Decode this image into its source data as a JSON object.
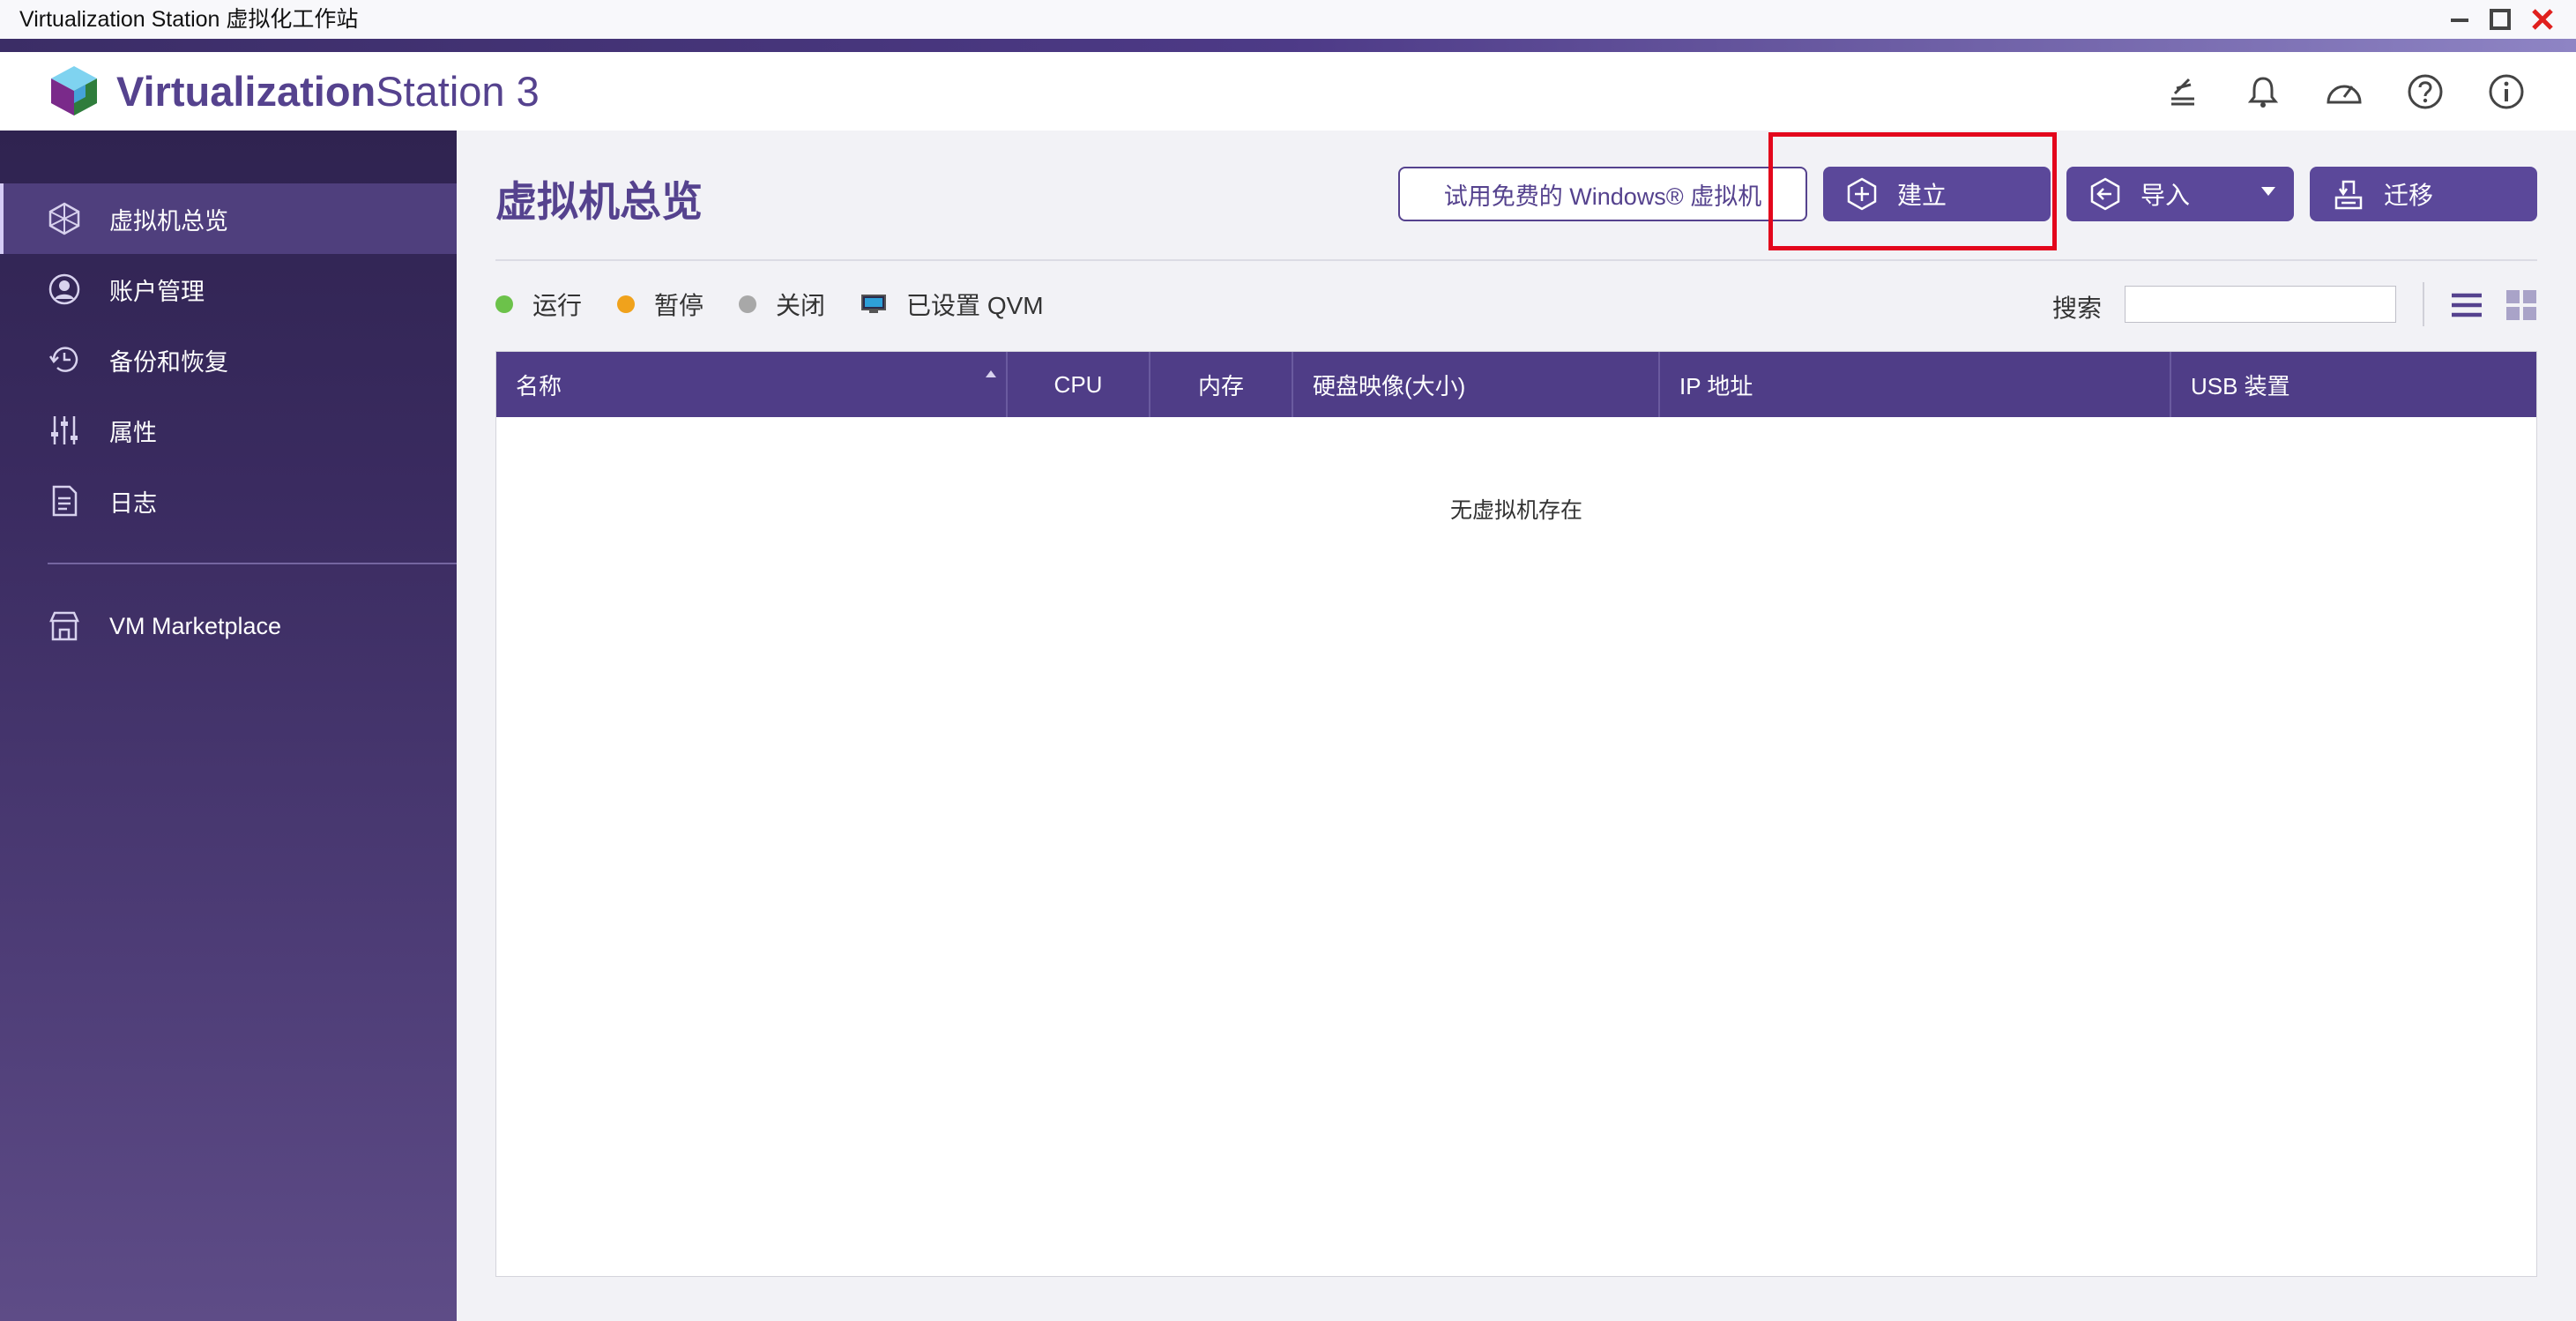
{
  "window": {
    "title": "Virtualization Station 虚拟化工作站",
    "controls": [
      "minimize",
      "maximize",
      "close"
    ]
  },
  "header": {
    "brand_bold": "Virtualization",
    "brand_light": "Station 3",
    "icons": [
      "tasks-icon",
      "bell-icon",
      "dashboard-icon",
      "help-icon",
      "info-icon"
    ]
  },
  "sidebar": {
    "items": [
      {
        "label": "虚拟机总览",
        "icon": "vm-overview-icon",
        "active": true
      },
      {
        "label": "账户管理",
        "icon": "account-icon",
        "active": false
      },
      {
        "label": "备份和恢复",
        "icon": "backup-icon",
        "active": false
      },
      {
        "label": "属性",
        "icon": "sliders-icon",
        "active": false
      },
      {
        "label": "日志",
        "icon": "log-icon",
        "active": false
      }
    ],
    "marketplace": {
      "label": "VM Marketplace",
      "icon": "store-icon"
    }
  },
  "main": {
    "title": "虚拟机总览",
    "buttons": {
      "try_windows": "试用免费的 Windows® 虚拟机",
      "create": "建立",
      "import": "导入",
      "migrate": "迁移"
    },
    "legend": [
      {
        "label": "运行",
        "color": "#6cc24a"
      },
      {
        "label": "暂停",
        "color": "#f0a21c"
      },
      {
        "label": "关闭",
        "color": "#a8a8a8"
      },
      {
        "label": "已设置 QVM",
        "icon": "monitor-icon"
      }
    ],
    "search": {
      "label": "搜索",
      "value": "",
      "placeholder": ""
    },
    "table": {
      "columns": [
        "名称",
        "CPU",
        "内存",
        "硬盘映像(大小)",
        "IP 地址",
        "USB 装置"
      ],
      "rows": [],
      "empty_text": "无虚拟机存在"
    }
  },
  "colors": {
    "brand": "#55428e",
    "sidebar": "#3a2b60",
    "button": "#5b489a",
    "highlight": "#e3061c"
  }
}
